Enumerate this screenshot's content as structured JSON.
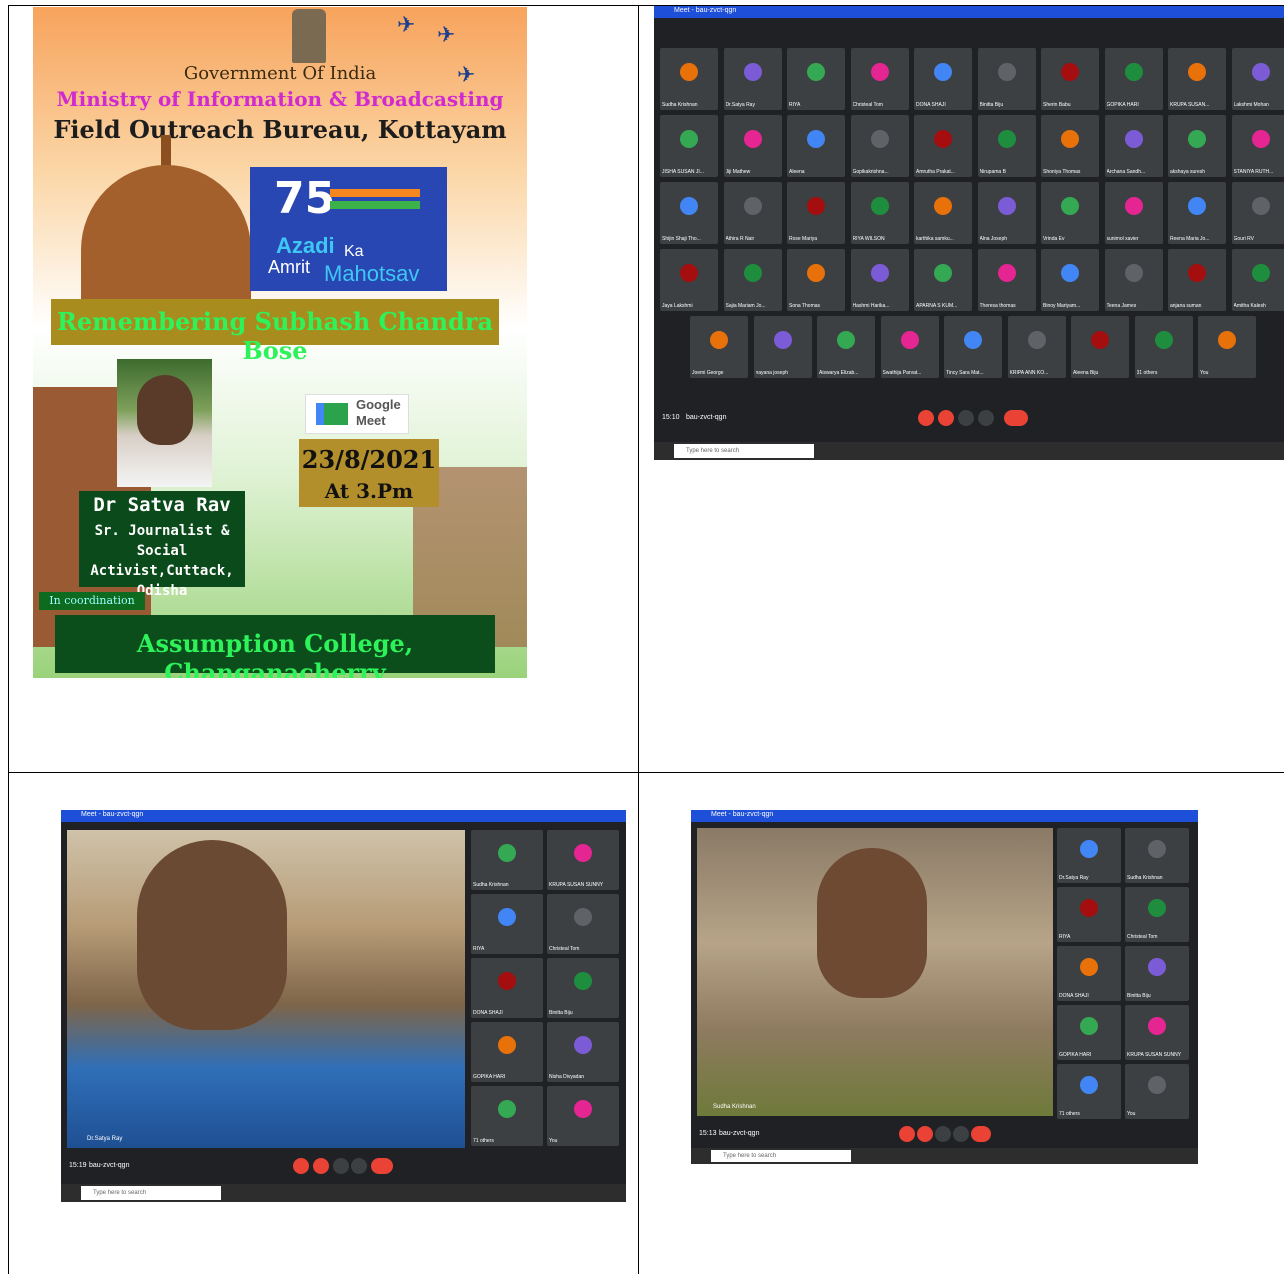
{
  "poster": {
    "gov": "Government Of India",
    "ministry": "Ministry of Information & Broadcasting",
    "bureau": "Field Outreach Bureau, Kottayam",
    "azadi_75": "75",
    "azadi_1": "Azadi",
    "azadi_2": "Ka",
    "azadi_3": "Amrit",
    "azadi_4": "Mahotsav",
    "remember": "Remembering Subhash Chandra Bose",
    "google_meet": "Google Meet",
    "date": "23/8/2021",
    "time": "At 3.Pm",
    "speaker_name": "Dr Satva Rav",
    "speaker_title": "Sr. Journalist & Social Activist,Cuttack, Odisha",
    "coordination": "In coordination",
    "college": "Assumption College, Changanacherry"
  },
  "meet1": {
    "title": "Meet - bau-zvct-qgn",
    "time": "15:10",
    "code": "bau-zvct-qgn",
    "search": "Type here to search",
    "participants": [
      "Sudha Krishnan",
      "Dr.Satya Ray",
      "RIYA",
      "Christeal Tom",
      "DONA SHAJI",
      "Binitta Biju",
      "Sherin Babu",
      "GOPIKA HARI",
      "KRUPA SUSAN...",
      "Lakshmi Mohan",
      "JISHA SUSAN JI...",
      "Jiji Mathew",
      "Aleena",
      "Gopikakrishna...",
      "Amrutha Prakat...",
      "Nirupama B",
      "Shoniya Thomas",
      "Archana Sandh...",
      "akshaya suresh",
      "STANIYA RUTH...",
      "Shijin Shaji Tho...",
      "Athira R Nair",
      "Rose Mariya",
      "RIYA WILSON",
      "karthika samku...",
      "Alna Joseph",
      "Vrinda Ev",
      "sunimol xavier",
      "Reena Maria Jo...",
      "Gouri RV",
      "Jaya Lakshmi",
      "Sajia Mariam Jo...",
      "Sona Thomas",
      "Hashmi Harika...",
      "APARNA S KUM...",
      "Theresa thomas",
      "Binoy Mariyam...",
      "Teena James",
      "anjana suman",
      "Amitha Kalesh",
      "Joemi George",
      "nayana joseph",
      "Aiswarya Elizab...",
      "Swathija Parvat...",
      "Tincy Sara Mat...",
      "KRIPA ANN KO...",
      "Aleena Biju",
      "31 others",
      "You"
    ],
    "others": "31 others"
  },
  "meet2": {
    "title": "Meet - bau-zvct-qgn",
    "speaker": "Dr.Satya Ray",
    "time": "15:19",
    "code": "bau-zvct-qgn",
    "search": "Type here to search",
    "tiles": [
      "Sudha Krishnan",
      "KRUPA SUSAN SUNNY",
      "RIYA",
      "Christeal Tom",
      "DONA SHAJI",
      "Binitta Biju",
      "GOPIKA HARI",
      "Nisha Divyadan",
      "71 others",
      "You"
    ]
  },
  "meet3": {
    "title": "Meet - bau-zvct-qgn",
    "speaker": "Sudha Krishnan",
    "time": "15:13",
    "code": "bau-zvct-qgn",
    "search": "Type here to search",
    "tiles": [
      "Dr.Satya Ray",
      "Sudha Krishnan",
      "RIYA",
      "Christeal Tom",
      "DONA SHAJI",
      "Binitta Biju",
      "GOPIKA HARI",
      "KRUPA SUSAN SUNNY",
      "71 others",
      "You"
    ]
  },
  "colors": {
    "meet_bg": "#202124",
    "tile": "#3c4043",
    "red": "#ea4335",
    "title_blue": "#1e4fd8",
    "poster_green": "#2ef25a"
  }
}
